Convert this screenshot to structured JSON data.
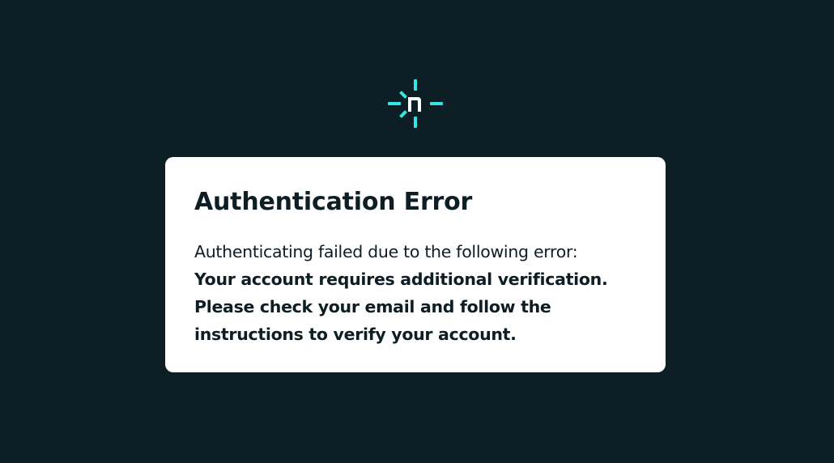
{
  "brand": {
    "logo_icon": "netlify-logo-icon",
    "logo_letter": "n",
    "accent_color": "#32e6e2"
  },
  "error_card": {
    "title": "Authentication Error",
    "intro_text": "Authenticating failed due to the following error:",
    "detail_text": "Your account requires additional verification. Please check your email and follow the instructions to verify your account."
  },
  "colors": {
    "background": "#0e1e25",
    "card": "#ffffff",
    "text": "#0e1e25"
  }
}
